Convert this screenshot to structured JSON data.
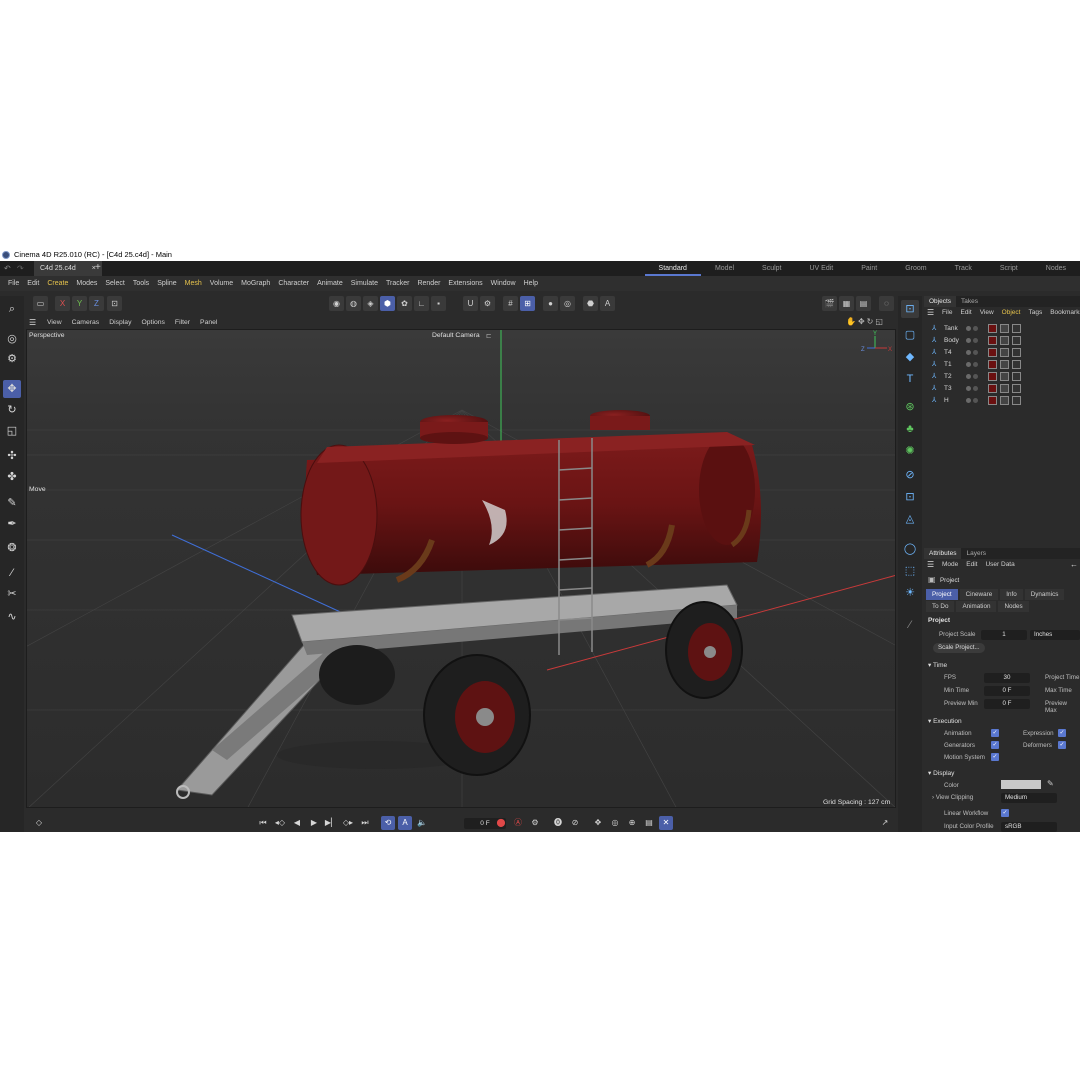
{
  "window": {
    "title": "Cinema 4D R25.010 (RC) - [C4d 25.c4d] - Main"
  },
  "doc_tab": {
    "name": "C4d 25.c4d",
    "close": "×",
    "add": "+"
  },
  "layouts": [
    "Standard",
    "Model",
    "Sculpt",
    "UV Edit",
    "Paint",
    "Groom",
    "Track",
    "Script",
    "Nodes"
  ],
  "main_menu": [
    "File",
    "Edit",
    "Create",
    "Modes",
    "Select",
    "Tools",
    "Spline",
    "Mesh",
    "Volume",
    "MoGraph",
    "Character",
    "Animate",
    "Simulate",
    "Tracker",
    "Render",
    "Extensions",
    "Window",
    "Help"
  ],
  "axis_buttons": [
    "X",
    "Y",
    "Z"
  ],
  "viewport_menu": [
    "View",
    "Cameras",
    "Display",
    "Options",
    "Filter",
    "Panel"
  ],
  "viewport": {
    "projection": "Perspective",
    "camera": "Default Camera",
    "tool_label": "Move",
    "grid_spacing": "Grid Spacing : 127 cm",
    "axis_z": "Z",
    "axis_y": "Y",
    "axis_x": "X"
  },
  "timeline": {
    "frame": "0 F"
  },
  "objects_panel": {
    "tabs": [
      "Objects",
      "Takes"
    ],
    "menu": [
      "File",
      "Edit",
      "View",
      "Object",
      "Tags",
      "Bookmarks"
    ],
    "objects": [
      "Tank",
      "Body",
      "T4",
      "T1",
      "T2",
      "T3",
      "H"
    ]
  },
  "attributes_panel": {
    "tabs": [
      "Attributes",
      "Layers"
    ],
    "menu": [
      "Mode",
      "Edit",
      "User Data"
    ],
    "object_label": "Project",
    "subtabs_row1": [
      "Project",
      "Cineware",
      "Info",
      "Dynamics"
    ],
    "subtabs_row2": [
      "To Do",
      "Animation",
      "Nodes"
    ],
    "section_project": "Project",
    "project_scale_label": "Project Scale",
    "project_scale_value": "1",
    "project_scale_unit": "Inches",
    "scale_project_button": "Scale Project...",
    "section_time": "Time",
    "fps_label": "FPS",
    "fps_value": "30",
    "project_time_label": "Project Time",
    "min_time_label": "Min Time",
    "min_time_value": "0 F",
    "max_time_label": "Max Time",
    "preview_min_label": "Preview Min",
    "preview_min_value": "0 F",
    "preview_max_label": "Preview Max",
    "section_execution": "Execution",
    "animation_label": "Animation",
    "expression_label": "Expression",
    "generators_label": "Generators",
    "deformers_label": "Deformers",
    "motion_system_label": "Motion System",
    "section_display": "Display",
    "color_label": "Color",
    "view_clipping_label": "View Clipping",
    "view_clipping_value": "Medium",
    "linear_workflow_label": "Linear Workflow",
    "input_color_profile_label": "Input Color Profile",
    "input_color_profile_value": "sRGB"
  },
  "colors": {
    "accent": "#4b5fa8",
    "tank": "#6e1414",
    "background": "#2b2b2b",
    "highlight_menu": "#e5c24c"
  }
}
